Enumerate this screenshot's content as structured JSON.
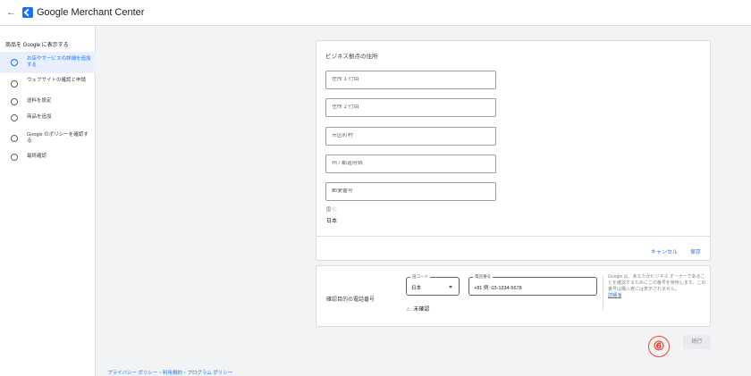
{
  "header": {
    "back_icon": "back-arrow-icon",
    "logo_icon": "merchant-center-logo",
    "title": "Google Merchant Center"
  },
  "sidebar": {
    "heading": "商品を Google に表示する",
    "steps": [
      {
        "label": "お店やサービスの詳細を追加する",
        "active": true
      },
      {
        "label": "ウェブサイトの確認と申請",
        "active": false
      },
      {
        "label": "送料を設定",
        "active": false
      },
      {
        "label": "商品を追加",
        "active": false
      },
      {
        "label": "Google のポリシーを確認する",
        "active": false
      },
      {
        "label": "最終確認",
        "active": false
      }
    ]
  },
  "address_card": {
    "title": "ビジネス拠点の住所",
    "fields": [
      {
        "placeholder": "住所 1 行目"
      },
      {
        "placeholder": "住所 2 行目"
      },
      {
        "placeholder": "市区町村"
      },
      {
        "placeholder": "州 / 都道府県"
      },
      {
        "placeholder": "郵便番号"
      }
    ],
    "country_label": "国 ⓘ",
    "country_value": "日本",
    "cancel_label": "キャンセル",
    "save_label": "保存"
  },
  "phone_card": {
    "label": "確認目的の電話番号",
    "country_code": {
      "legend": "国コード",
      "value": "日本"
    },
    "phone": {
      "legend": "電話番号",
      "value": "+81 例: 03-1234-5678"
    },
    "status": "未確認",
    "help_text": "Google は、あなたがビジネス オーナーであることを確認するためにこの番号を使用します。この番号は購入者には表示されません。",
    "help_link": "詳細 ⧉"
  },
  "badge": "⑥",
  "next_label": "続行",
  "footer": "プライバシー ポリシー・利用規約・プログラム ポリシー",
  "colors": {
    "accent": "#1a73e8",
    "warning": "#e37400",
    "badge": "#ea4335"
  }
}
